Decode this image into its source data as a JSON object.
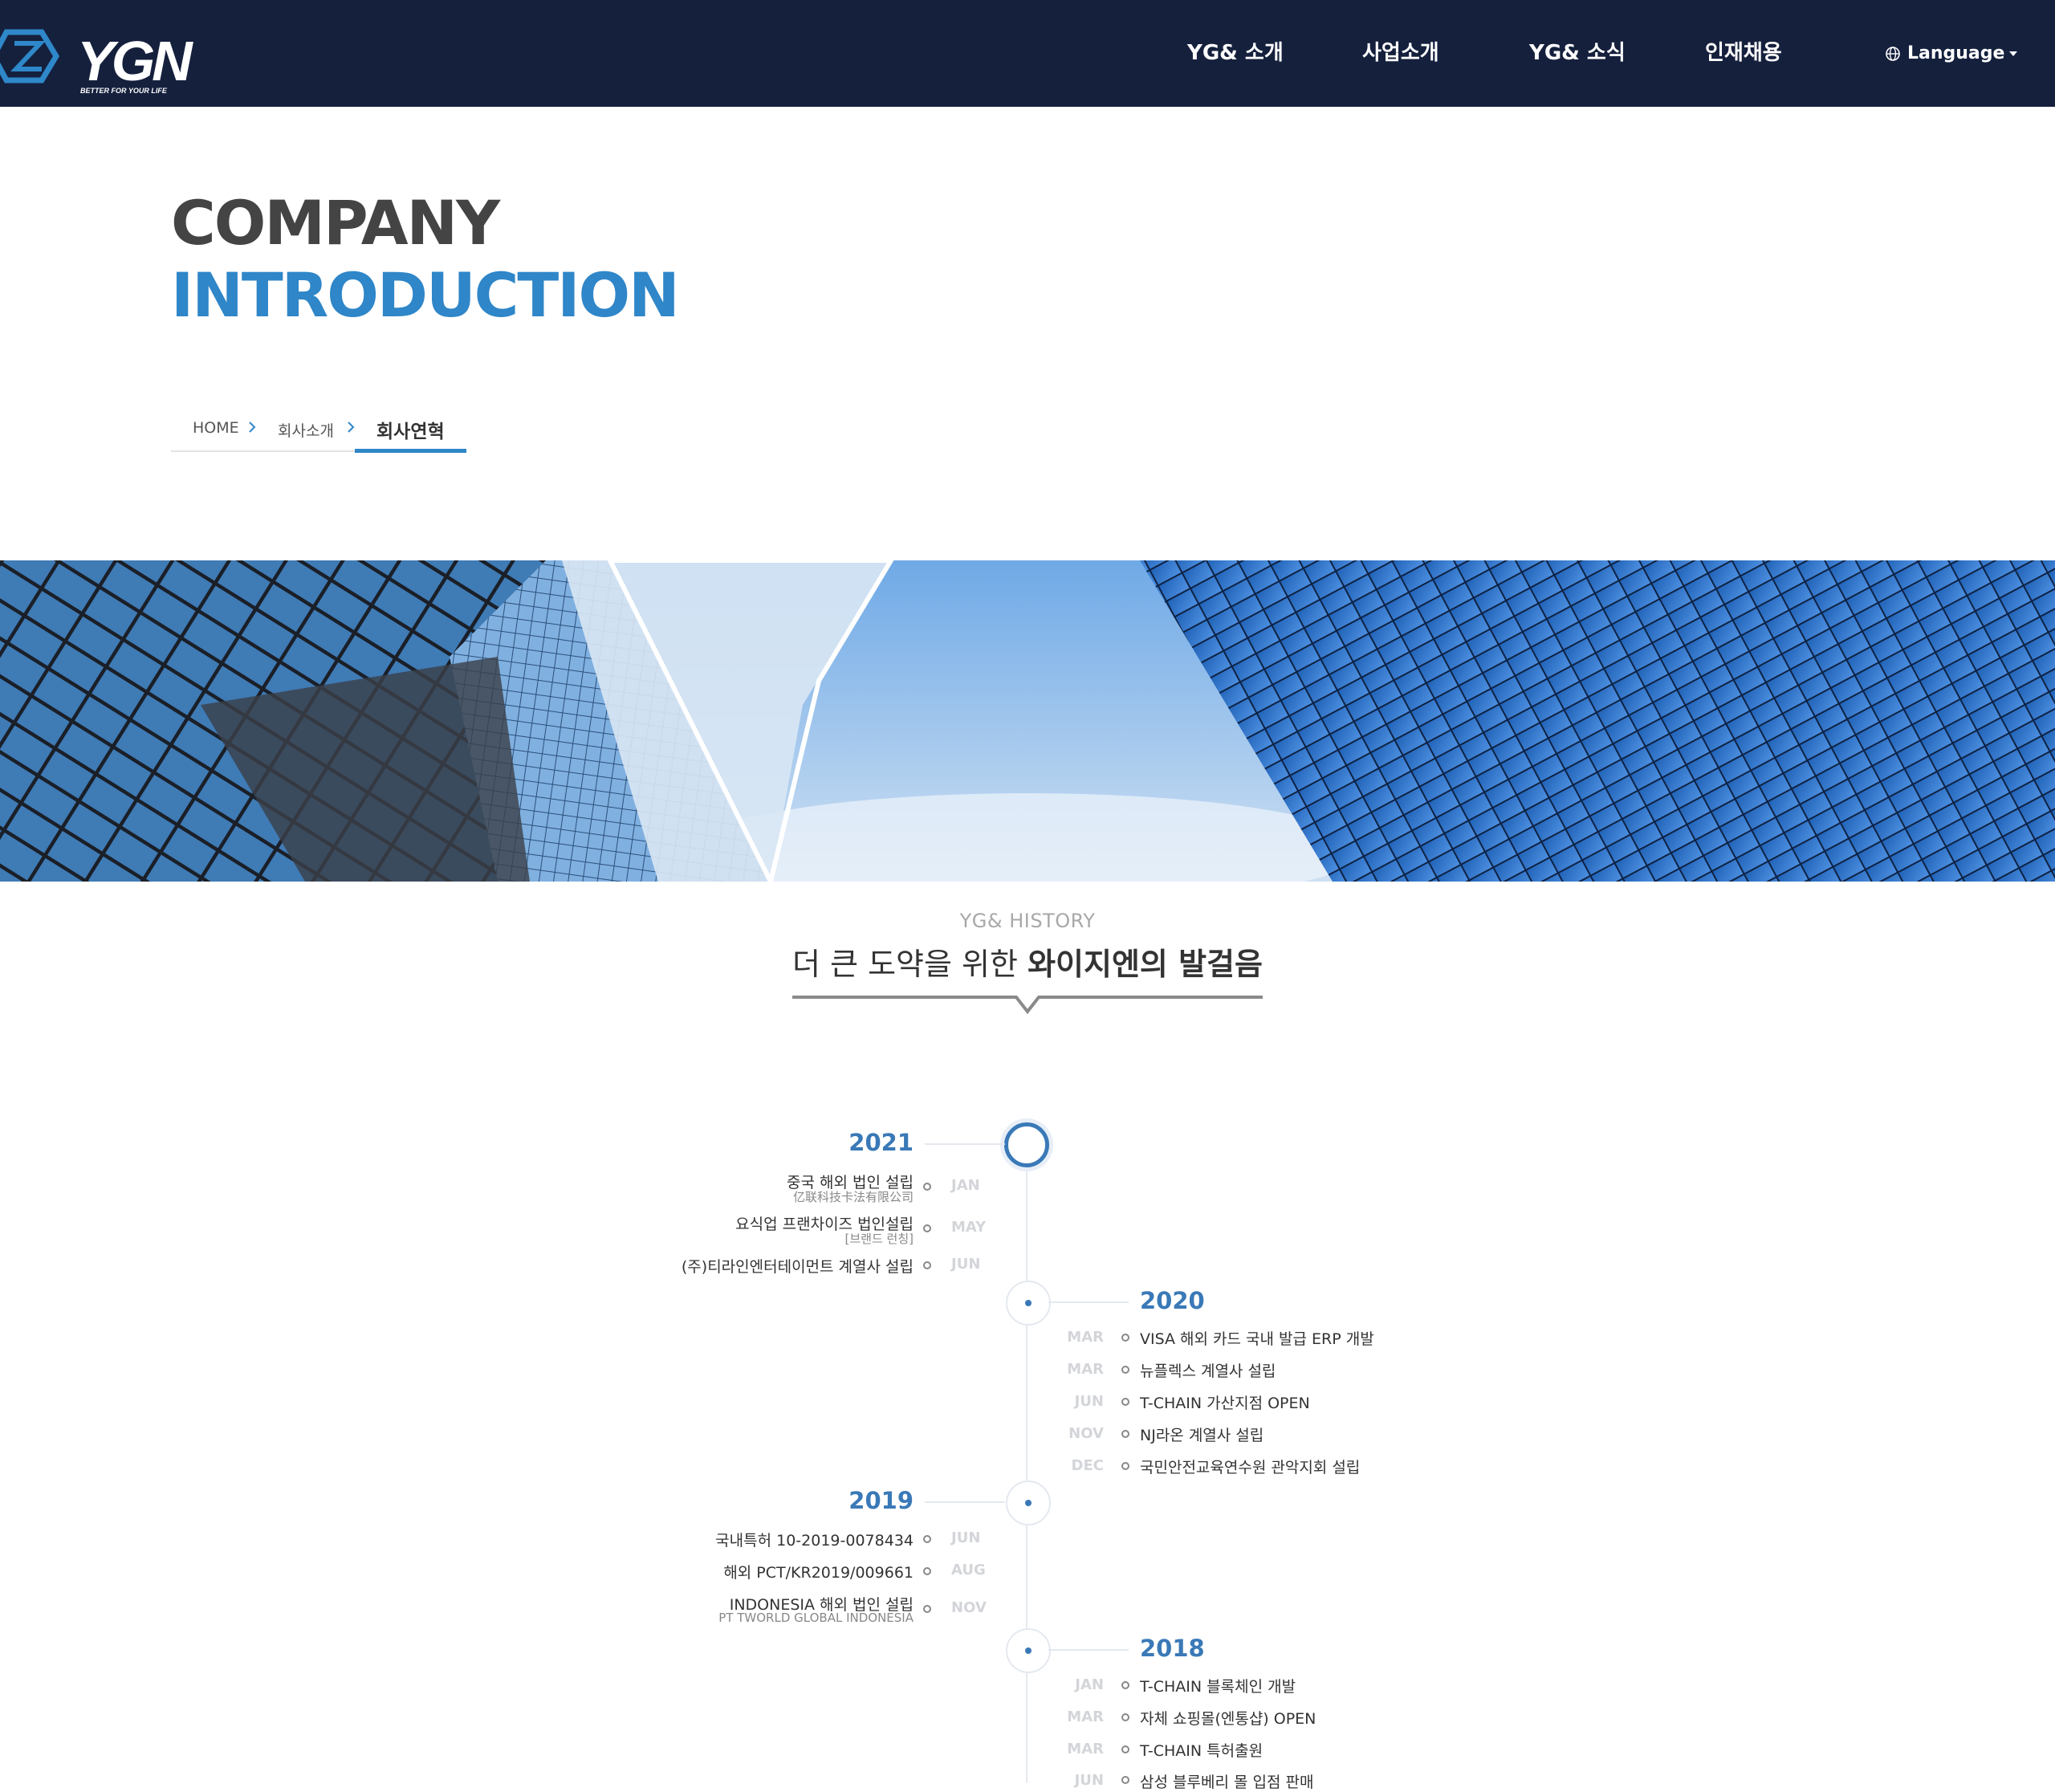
{
  "nav": {
    "logo_text": "YGN",
    "logo_tagline": "BETTER FOR YOUR LIFE",
    "items": [
      "YG& 소개",
      "사업소개",
      "YG& 소식",
      "인재채용"
    ],
    "language": "Language"
  },
  "hero": {
    "title_line1": "COMPANY",
    "title_line2": "INTRODUCTION"
  },
  "breadcrumb": {
    "home": "HOME",
    "section": "회사소개",
    "current": "회사연혁"
  },
  "history": {
    "subtitle": "YG& HISTORY",
    "title_normal": "더 큰 도약을 위한 ",
    "title_bold": "와이지엔의 발걸음",
    "years": [
      {
        "year": "2021",
        "side": "left",
        "events": [
          {
            "month": "JAN",
            "text": "중국 해외 법인 설립",
            "sub": "亿联科技卡法有限公司"
          },
          {
            "month": "MAY",
            "text": "요식업 프랜차이즈 법인설립",
            "sub": "[브랜드 런칭]"
          },
          {
            "month": "JUN",
            "text": "(주)티라인엔터테이먼트 계열사 설립",
            "sub": ""
          }
        ]
      },
      {
        "year": "2020",
        "side": "right",
        "events": [
          {
            "month": "MAR",
            "text": "VISA 해외 카드 국내 발급 ERP 개발",
            "sub": ""
          },
          {
            "month": "MAR",
            "text": "뉴플렉스 계열사 설립",
            "sub": ""
          },
          {
            "month": "JUN",
            "text": "T-CHAIN 가산지점 OPEN",
            "sub": ""
          },
          {
            "month": "NOV",
            "text": "NJ라온 계열사 설립",
            "sub": ""
          },
          {
            "month": "DEC",
            "text": "국민안전교육연수원 관악지회 설립",
            "sub": ""
          }
        ]
      },
      {
        "year": "2019",
        "side": "left",
        "events": [
          {
            "month": "JUN",
            "text": "국내특허 10-2019-0078434",
            "sub": ""
          },
          {
            "month": "AUG",
            "text": "해외 PCT/KR2019/009661",
            "sub": ""
          },
          {
            "month": "NOV",
            "text": "INDONESIA 해외 법인 설립",
            "sub": "PT TWORLD GLOBAL INDONESIA"
          }
        ]
      },
      {
        "year": "2018",
        "side": "right",
        "events": [
          {
            "month": "JAN",
            "text": "T-CHAIN 블록체인 개발",
            "sub": ""
          },
          {
            "month": "MAR",
            "text": "자체 쇼핑몰(엔통샵) OPEN",
            "sub": ""
          },
          {
            "month": "MAR",
            "text": "T-CHAIN 특허출원",
            "sub": ""
          },
          {
            "month": "JUN",
            "text": "삼성 블루베리 몰 입점 판매",
            "sub": ""
          }
        ]
      }
    ]
  },
  "colors": {
    "nav_bg": "#15203d",
    "accent": "#2f86c8",
    "timeline_accent": "#3a79b7"
  }
}
